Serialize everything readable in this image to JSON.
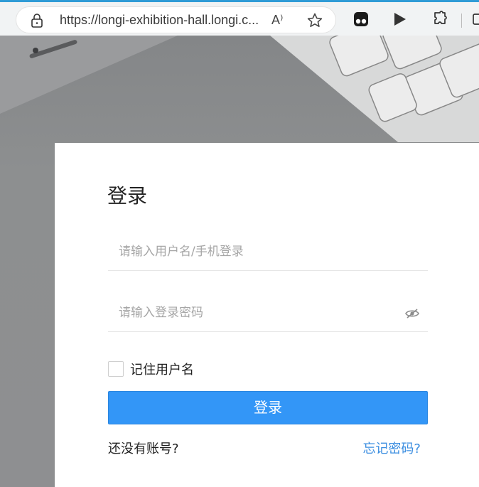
{
  "browser": {
    "url": "https://longi-exhibition-hall.longi.c...",
    "read_aloud_label": "A⁾"
  },
  "login": {
    "title": "登录",
    "username_placeholder": "请输入用户名/手机登录",
    "password_placeholder": "请输入登录密码",
    "remember_label": "记住用户名",
    "submit_label": "登录",
    "no_account_label": "还没有账号?",
    "forgot_label": "忘记密码?"
  },
  "colors": {
    "accent": "#3396f7",
    "link": "#3a8de0",
    "tab_bar": "#2f9bd6"
  }
}
